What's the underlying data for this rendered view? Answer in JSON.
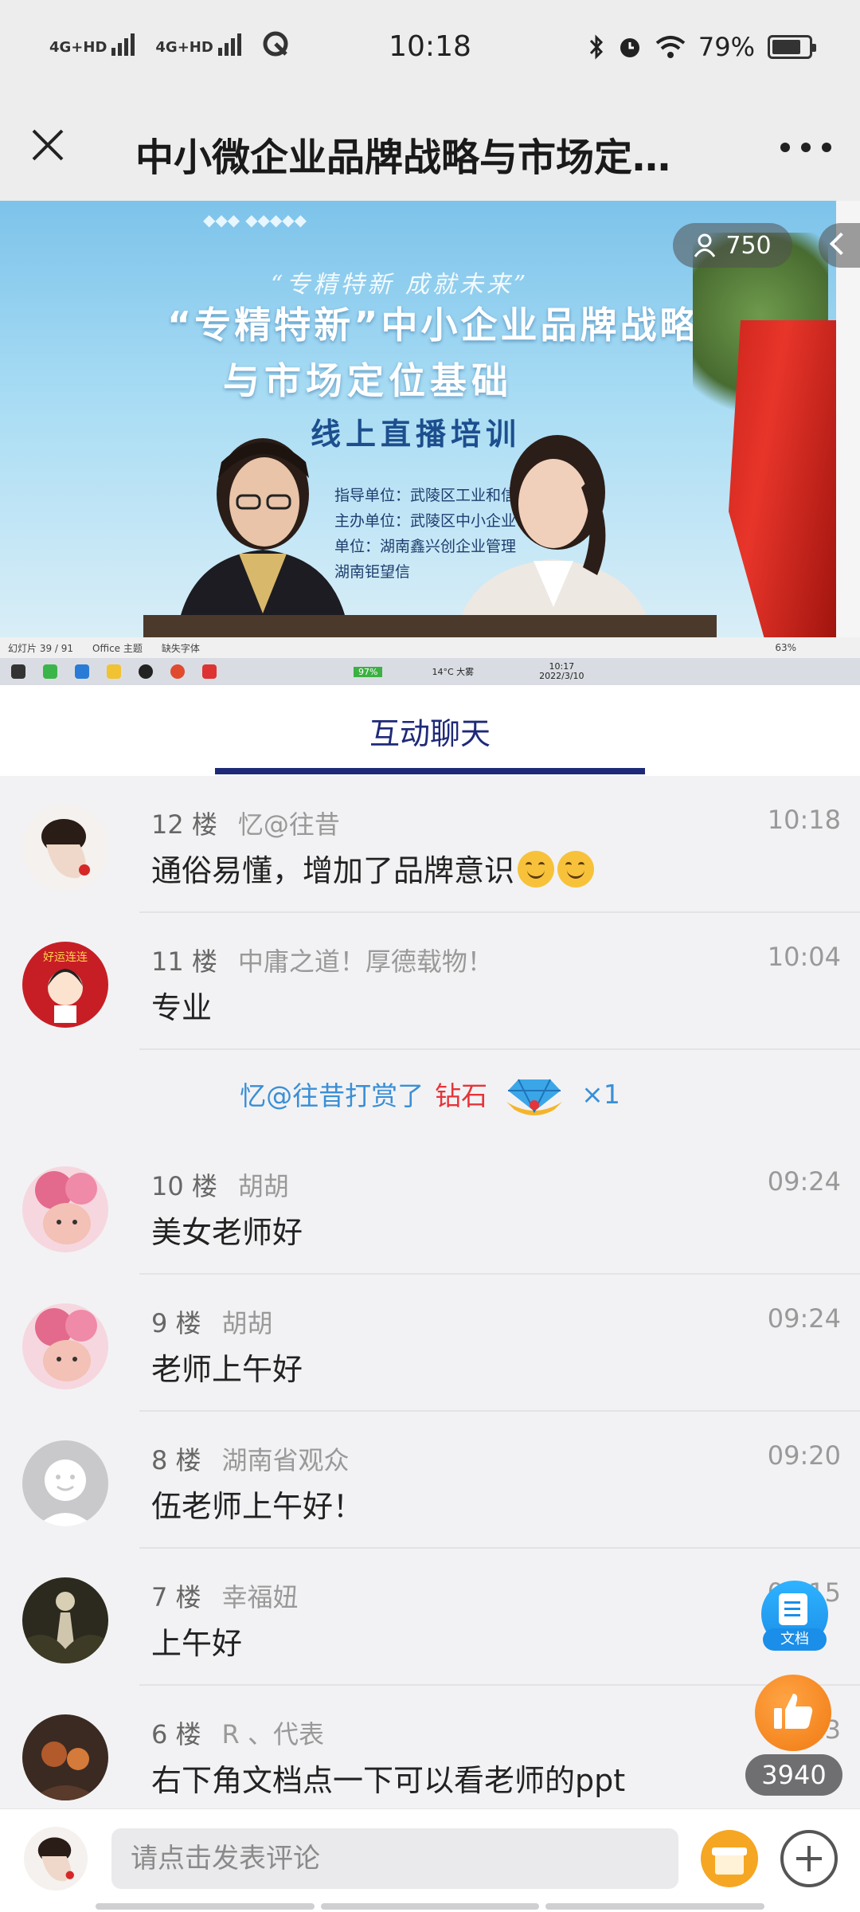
{
  "status_bar": {
    "network1": "4G+HD",
    "network2": "4G+HD",
    "time": "10:18",
    "battery": "79%",
    "battery_level": 0.79
  },
  "header": {
    "title": "中小微企业品牌战略与市场定位基础"
  },
  "video": {
    "viewers": "750",
    "banner_slogan": "“专精特新 成就未来”",
    "banner_line1": "“专精特新”中小企业品牌战略",
    "banner_line2": "与市场定位基础",
    "banner_line3": "线上直播培训",
    "banner_info": [
      "指导单位：武陵区工业和信息",
      "主办单位：武陵区中小企业公共",
      "单位：湖南鑫兴创企业管理",
      "湖南钜望信"
    ],
    "ppt_status": "幻灯片 39 / 91",
    "ppt_theme": "Office 主题",
    "ppt_font": "缺失字体",
    "ppt_zoom": "63%",
    "taskbar_battery": "97%",
    "taskbar_weather": "14°C 大雾",
    "taskbar_time": "10:17",
    "taskbar_date": "2022/3/10"
  },
  "tab": {
    "label": "互动聊天"
  },
  "messages": [
    {
      "floor": "12 楼",
      "nick": "忆@往昔",
      "time": "10:18",
      "text": "通俗易懂，增加了品牌意识"
    },
    {
      "floor": "11 楼",
      "nick": "中庸之道！厚德载物！",
      "time": "10:04",
      "text": "专业"
    },
    {
      "floor": "10 楼",
      "nick": "胡胡",
      "time": "09:24",
      "text": "美女老师好"
    },
    {
      "floor": "9 楼",
      "nick": "胡胡",
      "time": "09:24",
      "text": "老师上午好"
    },
    {
      "floor": "8 楼",
      "nick": "湖南省观众",
      "time": "09:20",
      "text": "伍老师上午好！"
    },
    {
      "floor": "7 楼",
      "nick": "幸福妞",
      "time": "09:15",
      "text": "上午好"
    },
    {
      "floor": "6 楼",
      "nick": "R 、代表",
      "time": "09:13",
      "text": "右下角文档点一下可以看老师的ppt"
    }
  ],
  "gift": {
    "user_action": "忆@往昔打赏了",
    "item": "钻石",
    "count": "×1"
  },
  "floating": {
    "doc_label": "文档",
    "like_count": "3940"
  },
  "input": {
    "placeholder": "请点击发表评论"
  },
  "colors": {
    "accent": "#1e2a78",
    "gift_user": "#3a8fd6",
    "gift_item": "#e5343a",
    "like_orange": "#f07a12"
  }
}
